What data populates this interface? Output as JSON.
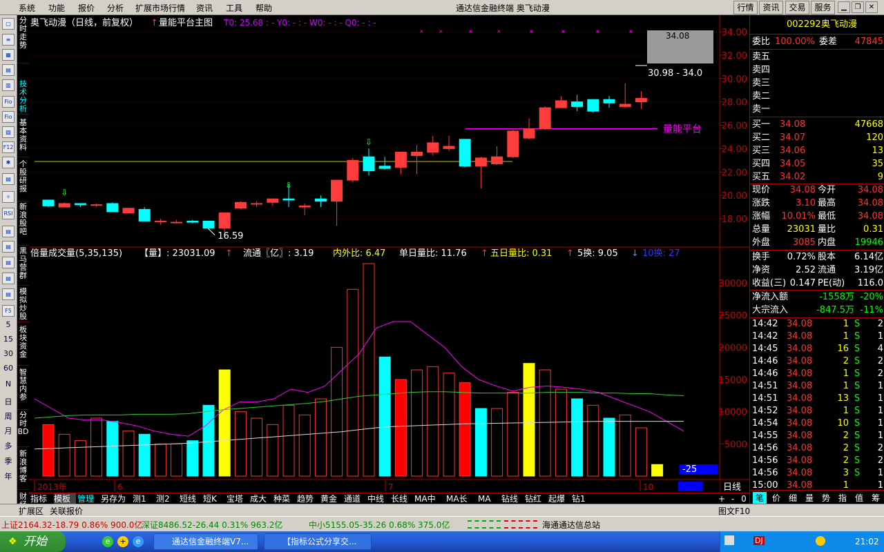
{
  "menu": {
    "items": [
      "系统",
      "功能",
      "报价",
      "分析",
      "扩展市场行情",
      "资讯",
      "工具",
      "帮助"
    ],
    "app_title": "通达信金融终端",
    "stock_title": "奥飞动漫",
    "right_buttons": [
      "行情",
      "资讯",
      "交易",
      "服务"
    ]
  },
  "left_vtabs": [
    "分时走势",
    "技术分析",
    "基本资料",
    "个股研报",
    "新浪股吧",
    "黑马营群",
    "模拟炒股",
    "板块资金",
    "智慧内参",
    "分时BD",
    "新浪博客",
    "财经"
  ],
  "left_numbers": [
    "5",
    "15",
    "30",
    "60",
    "N",
    "日",
    "周",
    "月",
    "多",
    "季",
    "年"
  ],
  "chart": {
    "header_name": "奥飞动漫（日线，前复权）",
    "header_indicator": "量能平台主图",
    "header_values": "T0: 25.68 : -  Y0: - : -  W0: - : -  Q0: - : -",
    "price_levels": [
      "34.00",
      "32.00",
      "30.00",
      "28.00",
      "26.00",
      "24.00",
      "22.00",
      "20.00",
      "18.00"
    ],
    "flag_price": "34.08",
    "range_label": "30.98 - 34.0",
    "low_label": "16.59",
    "platform_label": "量能平台",
    "vol_header": {
      "name": "倍量成交量(5,35,135)",
      "vol": "【量】: 23031.09",
      "float": "流通〖亿〗: 3.19",
      "inout": "内外比: 6.47",
      "single": "单日量比: 11.76",
      "five": "五日量比: 0.31",
      "turn5": "5换: 9.05",
      "turn10": "10换: 27"
    },
    "vol_levels": [
      "30000",
      "25000",
      "20000",
      "15000",
      "10000",
      "5000"
    ],
    "vol_tag": "-25",
    "date_labels": [
      "2013年",
      "6",
      "7",
      "10"
    ],
    "period_label": "日线",
    "chart_data": {
      "type": "candlestick",
      "ohlc": [
        [
          19.6,
          19.6,
          19.0,
          19.1
        ],
        [
          19.0,
          19.4,
          19.0,
          19.3
        ],
        [
          19.3,
          19.3,
          19.0,
          19.2
        ],
        [
          19.2,
          19.3,
          19.0,
          19.2
        ],
        [
          19.3,
          19.4,
          18.6,
          18.6
        ],
        [
          18.5,
          18.9,
          18.5,
          18.9
        ],
        [
          18.8,
          19.0,
          17.9,
          17.8
        ],
        [
          17.8,
          18.0,
          17.5,
          17.8
        ],
        [
          17.7,
          17.9,
          17.6,
          17.7
        ],
        [
          17.8,
          17.9,
          17.6,
          17.7
        ],
        [
          17.8,
          17.8,
          17.2,
          17.2
        ],
        [
          17.2,
          18.5,
          16.59,
          18.5
        ],
        [
          18.9,
          19.5,
          18.8,
          19.4
        ],
        [
          19.3,
          19.5,
          19.0,
          19.3
        ],
        [
          19.4,
          19.6,
          19.1,
          19.7
        ],
        [
          19.7,
          21.0,
          19.0,
          19.6
        ],
        [
          19.0,
          19.3,
          18.3,
          19.1
        ],
        [
          19.7,
          20.0,
          19.0,
          19.5
        ],
        [
          19.5,
          21.3,
          17.4,
          21.3
        ],
        [
          21.3,
          23.2,
          21.1,
          23.0
        ],
        [
          23.3,
          24.0,
          21.7,
          22.1
        ],
        [
          22.5,
          23.3,
          22.2,
          22.3
        ],
        [
          22.4,
          23.6,
          21.8,
          23.7
        ],
        [
          23.4,
          24.3,
          21.8,
          23.7
        ],
        [
          23.7,
          25.1,
          23.4,
          24.5
        ],
        [
          24.0,
          25.1,
          23.8,
          24.2
        ],
        [
          24.8,
          24.8,
          22.4,
          22.5
        ],
        [
          22.5,
          23.3,
          20.6,
          23.2
        ],
        [
          22.7,
          24.2,
          22.6,
          23.3
        ],
        [
          23.3,
          25.6,
          23.2,
          25.5
        ],
        [
          24.9,
          26.6,
          24.8,
          25.7
        ],
        [
          25.7,
          27.6,
          25.6,
          27.5
        ],
        [
          27.5,
          28.5,
          27.5,
          28.1
        ],
        [
          28.0,
          28.6,
          27.2,
          27.6
        ],
        [
          28.2,
          28.2,
          27.1,
          27.2
        ],
        [
          28.2,
          28.5,
          27.5,
          27.9
        ],
        [
          27.6,
          29.6,
          27.5,
          27.8
        ],
        [
          28.0,
          28.9,
          27.4,
          28.3
        ]
      ],
      "volume": [
        8000,
        6500,
        5500,
        9000,
        8500,
        7000,
        6500,
        5000,
        5000,
        5500,
        11000,
        16500,
        10000,
        9000,
        8000,
        11000,
        9500,
        12000,
        20000,
        29000,
        33000,
        18500,
        15000,
        16500,
        17000,
        16000,
        14500,
        10500,
        10500,
        13000,
        17500,
        16500,
        13500,
        12000,
        11000,
        9000,
        9500,
        7500,
        1800
      ]
    }
  },
  "right_panel": {
    "code": "002292",
    "name": "奥飞动漫",
    "webi_label": "委比",
    "webi_value": "100.00%",
    "weicha_label": "委差",
    "weicha_value": "47845",
    "sell_labels": [
      "卖五",
      "卖四",
      "卖三",
      "卖二",
      "卖一"
    ],
    "buys": [
      {
        "label": "买一",
        "price": "34.08",
        "vol": "47668"
      },
      {
        "label": "买二",
        "price": "34.07",
        "vol": "120"
      },
      {
        "label": "买三",
        "price": "34.06",
        "vol": "13"
      },
      {
        "label": "买四",
        "price": "34.05",
        "vol": "35"
      },
      {
        "label": "买五",
        "price": "34.02",
        "vol": "9"
      }
    ],
    "stats": [
      {
        "l1": "现价",
        "v1": "34.08",
        "l2": "今开",
        "v2": "34.08"
      },
      {
        "l1": "涨跌",
        "v1": "3.10",
        "l2": "最高",
        "v2": "34.08"
      },
      {
        "l1": "涨幅",
        "v1": "10.01%",
        "l2": "最低",
        "v2": "34.08"
      },
      {
        "l1": "总量",
        "v1": "23031",
        "l2": "量比",
        "v2": "0.31"
      },
      {
        "l1": "外盘",
        "v1": "3085",
        "l2": "内盘",
        "v2": "19946"
      }
    ],
    "stats2": [
      {
        "l1": "换手",
        "v1": "0.72%",
        "l2": "股本",
        "v2": "6.14亿"
      },
      {
        "l1": "净资",
        "v1": "2.52",
        "l2": "流通",
        "v2": "3.19亿"
      },
      {
        "l1": "收益(三)",
        "v1": "0.147",
        "l2": "PE(动)",
        "v2": "116.0"
      }
    ],
    "flows": [
      {
        "label": "净流入额",
        "value": "-1558万",
        "pct": "-20%"
      },
      {
        "label": "大宗流入",
        "value": "-847.5万",
        "pct": "-11%"
      }
    ],
    "ticks": [
      {
        "t": "14:42",
        "p": "34.08",
        "v": "1",
        "s": "S",
        "n": "2"
      },
      {
        "t": "14:42",
        "p": "34.08",
        "v": "1",
        "s": "S",
        "n": "1"
      },
      {
        "t": "14:45",
        "p": "34.08",
        "v": "16",
        "s": "S",
        "n": "4"
      },
      {
        "t": "14:46",
        "p": "34.08",
        "v": "2",
        "s": "S",
        "n": "2"
      },
      {
        "t": "14:46",
        "p": "34.08",
        "v": "1",
        "s": "S",
        "n": "2"
      },
      {
        "t": "14:51",
        "p": "34.08",
        "v": "1",
        "s": "S",
        "n": "1"
      },
      {
        "t": "14:51",
        "p": "34.08",
        "v": "13",
        "s": "S",
        "n": "1"
      },
      {
        "t": "14:52",
        "p": "34.08",
        "v": "1",
        "s": "S",
        "n": "1"
      },
      {
        "t": "14:54",
        "p": "34.08",
        "v": "10",
        "s": "S",
        "n": "1"
      },
      {
        "t": "14:55",
        "p": "34.08",
        "v": "2",
        "s": "S",
        "n": "1"
      },
      {
        "t": "14:56",
        "p": "34.08",
        "v": "2",
        "s": "S",
        "n": "2"
      },
      {
        "t": "14:56",
        "p": "34.08",
        "v": "2",
        "s": "S",
        "n": "2"
      },
      {
        "t": "14:56",
        "p": "34.08",
        "v": "3",
        "s": "S",
        "n": "1"
      },
      {
        "t": "15:00",
        "p": "34.08",
        "v": "1",
        "s": "",
        "n": "1"
      }
    ],
    "bottom_tabs": [
      "笔",
      "价",
      "细",
      "量",
      "势",
      "指",
      "值",
      "筹"
    ]
  },
  "bottom_tabs": [
    "指标",
    "模板",
    "管理",
    "另存为",
    "测1",
    "测2",
    "短线",
    "短K",
    "宝塔",
    "成大",
    "种菜",
    "趋势",
    "黄金",
    "通道",
    "中线",
    "长线",
    "MA中",
    "MA长",
    "MA",
    "钻线",
    "钻红",
    "起爆",
    "钻1"
  ],
  "bottom_right": [
    "+",
    "-",
    "0"
  ],
  "row2": {
    "items": [
      "扩展区",
      "关联报价"
    ],
    "right": "图文F10"
  },
  "statusbar": {
    "sh": "上证2164.32-18.79 0.86% 900.0亿",
    "sz": "深证8486.52-26.44 0.31% 963.2亿",
    "zx": "中小5155.05-35.26 0.68% 375.0亿",
    "station": "海通通达信总站"
  },
  "taskbar": {
    "start": "开始",
    "tasks": [
      "通达信金融终端V7...",
      "【指标公式分享交..."
    ],
    "clock": "21:02"
  },
  "colors": {
    "up": "#ff3c3c",
    "down": "#00ffff",
    "bg": "#000000",
    "grid": "#a00000",
    "yellow": "#ffff00",
    "magenta": "#ff00ff"
  }
}
